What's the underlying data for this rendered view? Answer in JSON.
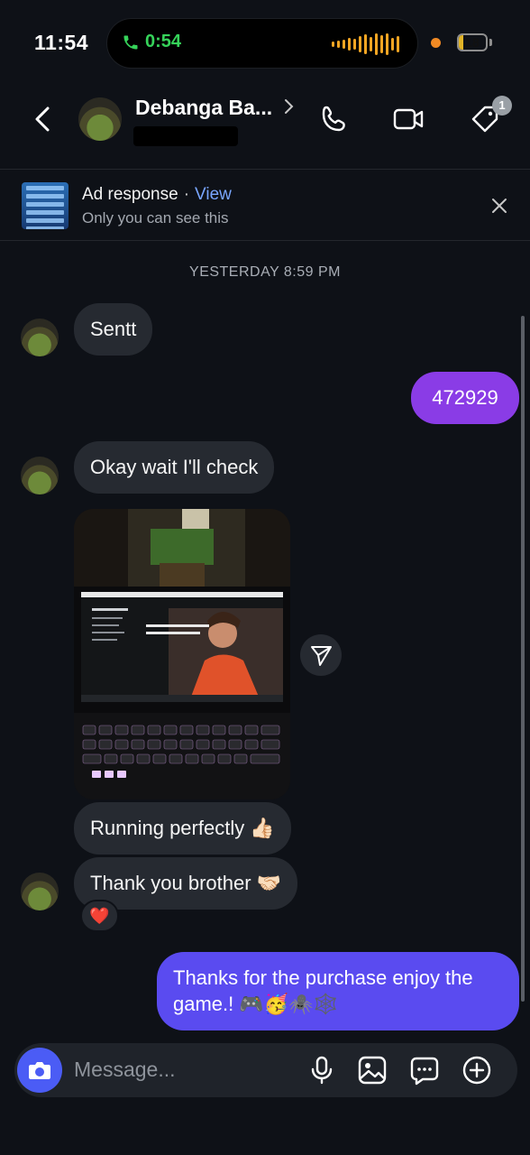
{
  "status_bar": {
    "time": "11:54",
    "call_duration": "0:54",
    "battery_level": "18"
  },
  "header": {
    "contact_name": "Debanga Ba...",
    "tag_badge_count": "1"
  },
  "ad_banner": {
    "title": "Ad response",
    "separator": "·",
    "view_link": "View",
    "subtitle": "Only you can see this"
  },
  "conversation": {
    "timestamp": "YESTERDAY 8:59 PM",
    "messages": [
      {
        "from": "them",
        "text": "Sentt"
      },
      {
        "from": "me",
        "text": "472929"
      },
      {
        "from": "them",
        "text": "Okay wait I'll check"
      },
      {
        "from": "them",
        "text": "Running perfectly 👍🏻"
      },
      {
        "from": "them",
        "text": "Thank you brother 🤝🏻"
      },
      {
        "from": "me",
        "text": "Thanks for the purchase enjoy the game.! 🎮🥳🕷️🕸️"
      }
    ],
    "reaction": "❤️"
  },
  "composer": {
    "placeholder": "Message..."
  },
  "colors": {
    "background": "#0e1117",
    "incoming_bubble": "#262a31",
    "outgoing_purple": "#8a3ce6",
    "outgoing_indigo": "#5a4bf0",
    "link_blue": "#79a6ff",
    "camera_button": "#4b5cf5"
  }
}
